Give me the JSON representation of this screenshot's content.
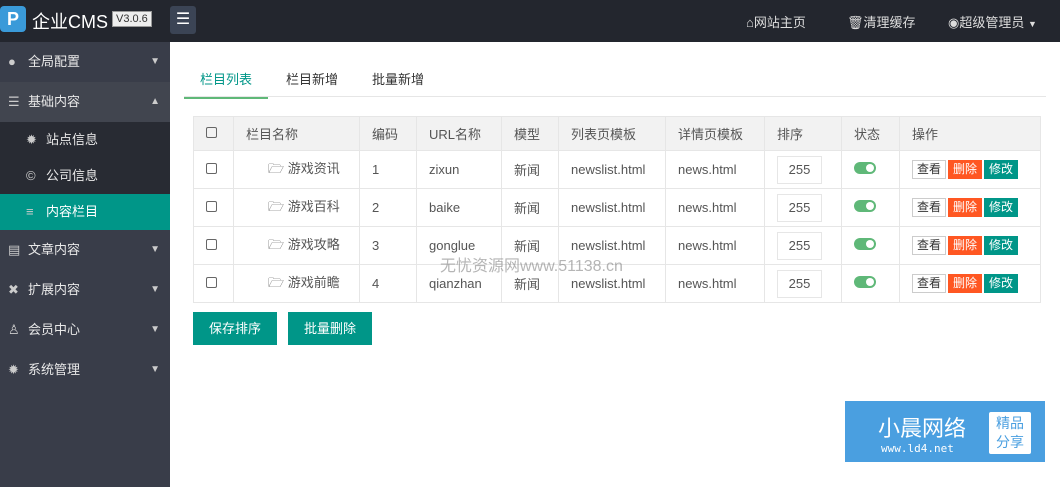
{
  "header": {
    "logo": "P",
    "brand": "企业CMS",
    "version": "V3.0.6",
    "links": [
      "网站主页",
      "清理缓存",
      "超级管理员"
    ]
  },
  "sidebar": {
    "items": [
      {
        "label": "全局配置",
        "icon": "globe-icon"
      },
      {
        "label": "基础内容",
        "icon": "sliders-icon"
      },
      {
        "label": "文章内容",
        "icon": "file-icon"
      },
      {
        "label": "扩展内容",
        "icon": "expand-icon"
      },
      {
        "label": "会员中心",
        "icon": "user-icon"
      },
      {
        "label": "系统管理",
        "icon": "gear-icon"
      }
    ],
    "sub": [
      "站点信息",
      "公司信息",
      "内容栏目"
    ]
  },
  "tabs": [
    "栏目列表",
    "栏目新增",
    "批量新增"
  ],
  "table": {
    "headers": [
      "栏目名称",
      "编码",
      "URL名称",
      "模型",
      "列表页模板",
      "详情页模板",
      "排序",
      "状态",
      "操作"
    ],
    "rows": [
      [
        "游戏资讯",
        "1",
        "zixun",
        "新闻",
        "newslist.html",
        "news.html",
        "255"
      ],
      [
        "游戏百科",
        "2",
        "baike",
        "新闻",
        "newslist.html",
        "news.html",
        "255"
      ],
      [
        "游戏攻略",
        "3",
        "gonglue",
        "新闻",
        "newslist.html",
        "news.html",
        "255"
      ],
      [
        "游戏前瞻",
        "4",
        "qianzhan",
        "新闻",
        "newslist.html",
        "news.html",
        "255"
      ]
    ],
    "actions": [
      "查看",
      "删除",
      "修改"
    ]
  },
  "buttons": {
    "save_sort": "保存排序",
    "batch_delete": "批量删除"
  },
  "watermark": "无忧资源网www.51138.cn",
  "badge": {
    "title": "小晨网络",
    "url": "www.ld4.net",
    "tag1": "精品",
    "tag2": "分享"
  },
  "colors": {
    "accent": "#009688",
    "danger": "#ff5722",
    "switch": "#5fb878"
  }
}
